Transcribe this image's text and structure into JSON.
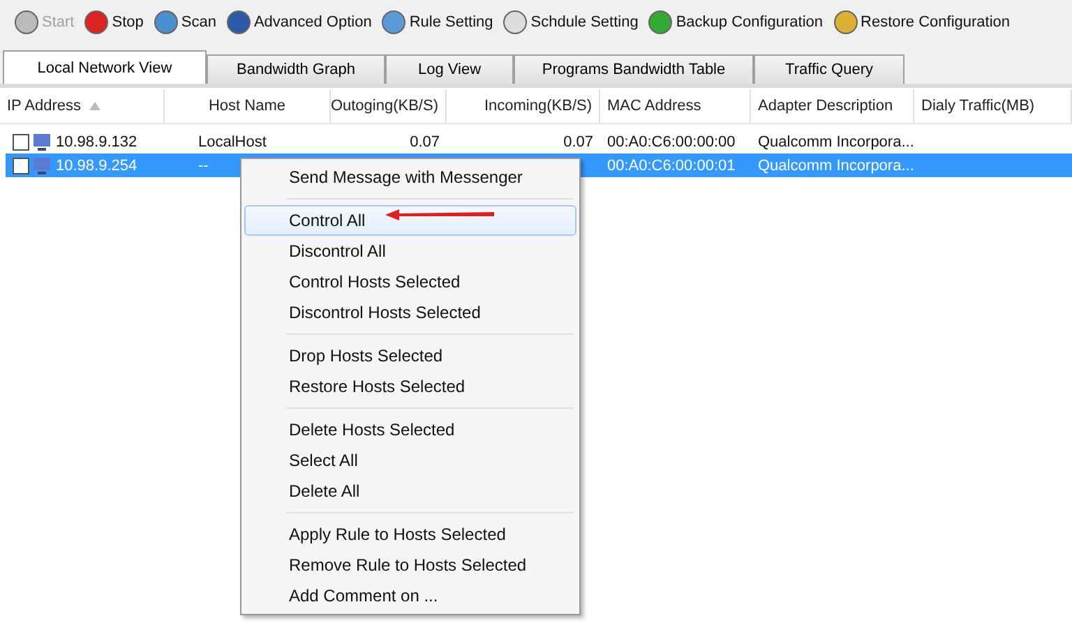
{
  "toolbar": [
    {
      "label": "Start",
      "disabled": true
    },
    {
      "label": "Stop",
      "disabled": false
    },
    {
      "label": "Scan",
      "disabled": false
    },
    {
      "label": "Advanced Option",
      "disabled": false
    },
    {
      "label": "Rule Setting",
      "disabled": false
    },
    {
      "label": "Schdule Setting",
      "disabled": false
    },
    {
      "label": "Backup Configuration",
      "disabled": false
    },
    {
      "label": "Restore Configuration",
      "disabled": false
    }
  ],
  "tabs": [
    {
      "label": "Local Network View",
      "selected": true
    },
    {
      "label": "Bandwidth Graph",
      "selected": false
    },
    {
      "label": "Log View",
      "selected": false
    },
    {
      "label": "Programs Bandwidth Table",
      "selected": false
    },
    {
      "label": "Traffic Query",
      "selected": false
    }
  ],
  "table": {
    "columns": [
      {
        "label": "IP Address",
        "sorted": true
      },
      {
        "label": "Host Name",
        "sorted": false
      },
      {
        "label": "Outoging(KB/S)",
        "sorted": false
      },
      {
        "label": "Incoming(KB/S)",
        "sorted": false
      },
      {
        "label": "MAC Address",
        "sorted": false
      },
      {
        "label": "Adapter Description",
        "sorted": false
      },
      {
        "label": "Dialy Traffic(MB)",
        "sorted": false
      }
    ],
    "rows": [
      {
        "checked": false,
        "selected": false,
        "ip": "10.98.9.132",
        "host": "LocalHost",
        "outgoing": "0.07",
        "incoming": "0.07",
        "mac": "00:A0:C6:00:00:00",
        "adapter": "Qualcomm Incorpora..."
      },
      {
        "checked": false,
        "selected": true,
        "ip": "10.98.9.254",
        "host": "--",
        "mac": "00:A0:C6:00:00:01",
        "adapter": "Qualcomm Incorpora..."
      }
    ]
  },
  "context_menu": {
    "groups": [
      [
        {
          "label": "Send Message with Messenger",
          "highlighted": false
        }
      ],
      [
        {
          "label": "Control All",
          "highlighted": true
        },
        {
          "label": "Discontrol All",
          "highlighted": false
        },
        {
          "label": "Control Hosts Selected",
          "highlighted": false
        },
        {
          "label": "Discontrol Hosts Selected",
          "highlighted": false
        }
      ],
      [
        {
          "label": "Drop Hosts Selected",
          "highlighted": false
        },
        {
          "label": "Restore Hosts Selected",
          "highlighted": false
        }
      ],
      [
        {
          "label": "Delete Hosts Selected",
          "highlighted": false
        },
        {
          "label": "Select All",
          "highlighted": false
        },
        {
          "label": "Delete All",
          "highlighted": false
        }
      ],
      [
        {
          "label": "Apply Rule to Hosts Selected",
          "highlighted": false
        },
        {
          "label": "Remove Rule to Hosts Selected",
          "highlighted": false
        },
        {
          "label": "Add Comment on ...",
          "highlighted": false
        }
      ]
    ]
  }
}
